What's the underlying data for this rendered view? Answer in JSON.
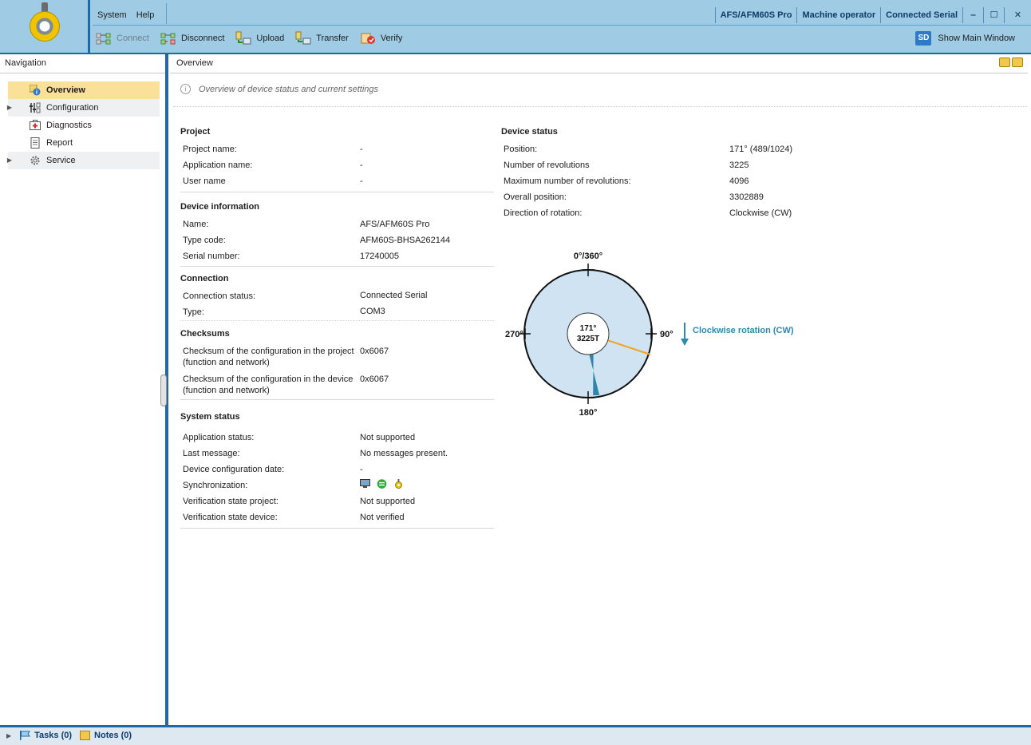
{
  "menu": {
    "system": "System",
    "help": "Help"
  },
  "status": {
    "device": "AFS/AFM60S Pro",
    "role": "Machine operator",
    "connection": "Connected Serial",
    "minimize": "‒",
    "maximize": "☐",
    "close": "✕"
  },
  "toolbar": {
    "connect": "Connect",
    "disconnect": "Disconnect",
    "upload": "Upload",
    "transfer": "Transfer",
    "verify": "Verify",
    "show_main": "Show Main Window",
    "sd_badge": "SD"
  },
  "nav": {
    "header": "Navigation",
    "items": [
      {
        "label": "Overview",
        "icon": "overview-icon"
      },
      {
        "label": "Configuration",
        "icon": "configuration-icon"
      },
      {
        "label": "Diagnostics",
        "icon": "diagnostics-icon"
      },
      {
        "label": "Report",
        "icon": "report-icon"
      },
      {
        "label": "Service",
        "icon": "gear-icon"
      }
    ]
  },
  "main": {
    "header": "Overview",
    "info": "Overview of device status and current settings"
  },
  "project": {
    "title": "Project",
    "rows": [
      {
        "label": "Project name:",
        "value": "-"
      },
      {
        "label": "Application name:",
        "value": "-"
      },
      {
        "label": "User name",
        "value": "-"
      }
    ]
  },
  "device_info": {
    "title": "Device information",
    "rows": [
      {
        "label": "Name:",
        "value": "AFS/AFM60S Pro"
      },
      {
        "label": "Type code:",
        "value": "AFM60S-BHSA262144"
      },
      {
        "label": "Serial number:",
        "value": "17240005"
      }
    ]
  },
  "connection": {
    "title": "Connection",
    "rows": [
      {
        "label": "Connection status:",
        "value": "Connected Serial"
      },
      {
        "label": "Type:",
        "value": "COM3"
      }
    ]
  },
  "checksums": {
    "title": "Checksums",
    "rows": [
      {
        "label1": "Checksum of the configuration in the project",
        "label2": "(function and network)",
        "value": "0x6067"
      },
      {
        "label1": "Checksum of the configuration in the device",
        "label2": "(function and network)",
        "value": "0x6067"
      }
    ]
  },
  "system_status": {
    "title": "System status",
    "rows": [
      {
        "label": "Application status:",
        "value": "Not supported"
      },
      {
        "label": "Last message:",
        "value": "No messages present."
      },
      {
        "label": "Device configuration date:",
        "value": "-"
      },
      {
        "label": "Synchronization:",
        "value": ""
      },
      {
        "label": "Verification state project:",
        "value": "Not supported"
      },
      {
        "label": "Verification state device:",
        "value": "Not verified"
      }
    ]
  },
  "device_status": {
    "title": "Device status",
    "rows": [
      {
        "label": "Position:",
        "value": "171° (489/1024)"
      },
      {
        "label": "Number of revolutions",
        "value": "3225"
      },
      {
        "label": "Maximum number of revolutions:",
        "value": "4096"
      },
      {
        "label": "Overall position:",
        "value": "3302889"
      },
      {
        "label": "Direction of rotation:",
        "value": "Clockwise (CW)"
      }
    ]
  },
  "dial": {
    "label_top": "0°/360°",
    "label_right": "90°",
    "label_bottom": "180°",
    "label_left": "270°",
    "center_angle": "171°",
    "center_turns": "3225T",
    "position_deg": 171,
    "direction_label": "Clockwise rotation (CW)",
    "colors": {
      "face": "#cfe3f2",
      "pointer": "#2e86a8",
      "marker": "#f0a51e",
      "direction": "#2a8ab3"
    }
  },
  "bottom": {
    "tasks": "Tasks (0)",
    "notes": "Notes (0)"
  }
}
